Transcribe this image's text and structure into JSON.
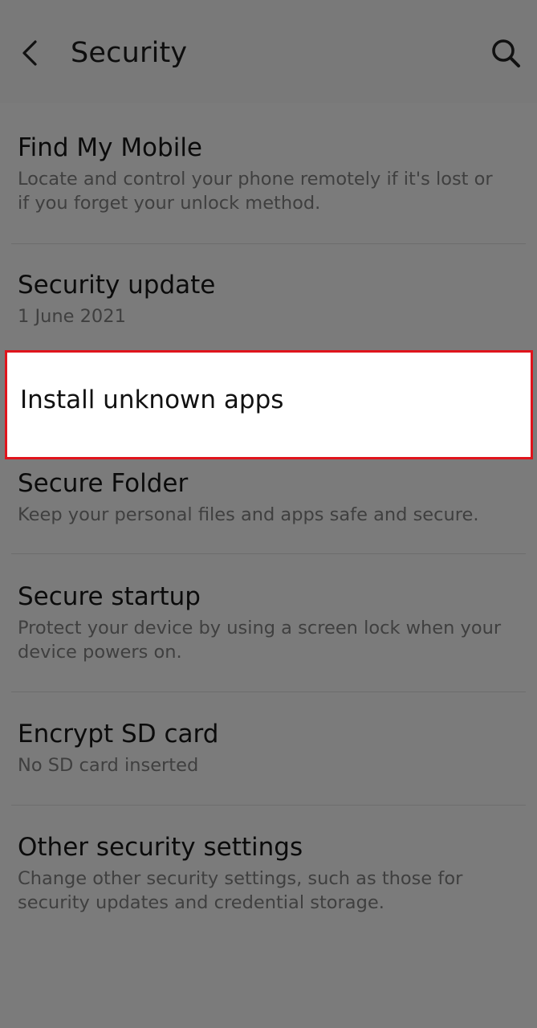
{
  "header": {
    "title": "Security",
    "back_icon": "chevron-left-icon",
    "search_icon": "search-icon"
  },
  "items": [
    {
      "title": "Find My Mobile",
      "subtitle": "Locate and control your phone remotely if it's lost or if you forget your unlock method."
    },
    {
      "title": "Security update",
      "subtitle": "1 June 2021"
    },
    {
      "title": "Install unknown apps",
      "highlighted": true
    },
    {
      "title": "Secure Folder",
      "subtitle": "Keep your personal files and apps safe and secure."
    },
    {
      "title": "Secure startup",
      "subtitle": "Protect your device by using a screen lock when your device powers on."
    },
    {
      "title": "Encrypt SD card",
      "subtitle": "No SD card inserted"
    },
    {
      "title": "Other security settings",
      "subtitle": "Change other security settings, such as those for security updates and credential storage."
    }
  ],
  "colors": {
    "dim_overlay": "#7b7b7b",
    "highlight_border": "#e0141c",
    "highlight_background": "#ffffff"
  }
}
